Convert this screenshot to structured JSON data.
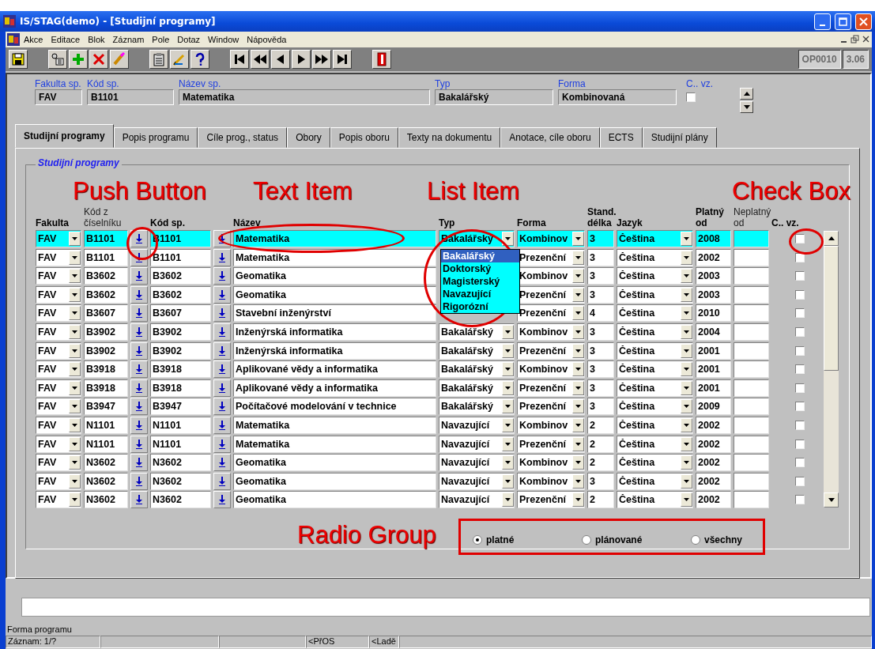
{
  "window": {
    "title": "IS/STAG(demo) - [Studijní programy]"
  },
  "menu": [
    "Akce",
    "Editace",
    "Blok",
    "Záznam",
    "Pole",
    "Dotaz",
    "Window",
    "Nápověda"
  ],
  "toolbar": {
    "form_code": "OP0010",
    "version": "3.06"
  },
  "header": {
    "fields": [
      {
        "label": "Fakulta sp.",
        "value": "FAV"
      },
      {
        "label": "Kód sp.",
        "value": "B1101"
      },
      {
        "label": "Název sp.",
        "value": "Matematika"
      },
      {
        "label": "Typ",
        "value": "Bakalářský"
      },
      {
        "label": "Forma",
        "value": "Kombinovaná"
      }
    ],
    "c_vz": {
      "label": "C.. vz.",
      "checked": false
    }
  },
  "tabs": [
    {
      "label": "Studijní programy",
      "selected": true
    },
    {
      "label": "Popis programu",
      "selected": false
    },
    {
      "label": "Cíle prog., status",
      "selected": false
    },
    {
      "label": "Obory",
      "selected": false
    },
    {
      "label": "Popis oboru",
      "selected": false
    },
    {
      "label": "Texty na dokumentu",
      "selected": false
    },
    {
      "label": "Anotace, cíle oboru",
      "selected": false
    },
    {
      "label": "ECTS",
      "selected": false
    },
    {
      "label": "Studijní plány",
      "selected": false
    }
  ],
  "group": {
    "title": "Studijní programy"
  },
  "table": {
    "columns": [
      "Fakulta",
      "Kód z číselníku",
      "Kód sp.",
      "Název",
      "Typ",
      "Forma",
      "Stand. délka",
      "Jazyk",
      "Platný od",
      "Neplatný od",
      "C.. vz."
    ],
    "rows": [
      {
        "fakulta": "FAV",
        "kod_ciselnik": "B1101",
        "kod_sp": "B1101",
        "nazev": "Matematika",
        "typ": "Bakalářský",
        "forma": "Kombinov",
        "delka": "3",
        "jazyk": "Čeština",
        "platny_od": "2008",
        "c_vz": false,
        "selected": true
      },
      {
        "fakulta": "FAV",
        "kod_ciselnik": "B1101",
        "kod_sp": "B1101",
        "nazev": "Matematika",
        "forma": "Prezenční",
        "delka": "3",
        "jazyk": "Čeština",
        "platny_od": "2002",
        "c_vz": false,
        "selected": false
      },
      {
        "fakulta": "FAV",
        "kod_ciselnik": "B3602",
        "kod_sp": "B3602",
        "nazev": "Geomatika",
        "forma": "Kombinov",
        "delka": "3",
        "jazyk": "Čeština",
        "platny_od": "2003",
        "c_vz": false,
        "selected": false
      },
      {
        "fakulta": "FAV",
        "kod_ciselnik": "B3602",
        "kod_sp": "B3602",
        "nazev": "Geomatika",
        "forma": "Prezenční",
        "delka": "3",
        "jazyk": "Čeština",
        "platny_od": "2003",
        "c_vz": false,
        "selected": false
      },
      {
        "fakulta": "FAV",
        "kod_ciselnik": "B3607",
        "kod_sp": "B3607",
        "nazev": "Stavební inženýrství",
        "forma": "Prezenční",
        "delka": "4",
        "jazyk": "Čeština",
        "platny_od": "2010",
        "c_vz": false,
        "selected": false
      },
      {
        "fakulta": "FAV",
        "kod_ciselnik": "B3902",
        "kod_sp": "B3902",
        "nazev": "Inženýrská informatika",
        "typ": "Bakalářský",
        "forma": "Kombinov",
        "delka": "3",
        "jazyk": "Čeština",
        "platny_od": "2004",
        "c_vz": false,
        "selected": false
      },
      {
        "fakulta": "FAV",
        "kod_ciselnik": "B3902",
        "kod_sp": "B3902",
        "nazev": "Inženýrská informatika",
        "typ": "Bakalářský",
        "forma": "Prezenční",
        "delka": "3",
        "jazyk": "Čeština",
        "platny_od": "2001",
        "c_vz": false,
        "selected": false
      },
      {
        "fakulta": "FAV",
        "kod_ciselnik": "B3918",
        "kod_sp": "B3918",
        "nazev": "Aplikované vědy a informatika",
        "typ": "Bakalářský",
        "forma": "Kombinov",
        "delka": "3",
        "jazyk": "Čeština",
        "platny_od": "2001",
        "c_vz": false,
        "selected": false
      },
      {
        "fakulta": "FAV",
        "kod_ciselnik": "B3918",
        "kod_sp": "B3918",
        "nazev": "Aplikované vědy a informatika",
        "typ": "Bakalářský",
        "forma": "Prezenční",
        "delka": "3",
        "jazyk": "Čeština",
        "platny_od": "2001",
        "c_vz": false,
        "selected": false
      },
      {
        "fakulta": "FAV",
        "kod_ciselnik": "B3947",
        "kod_sp": "B3947",
        "nazev": "Počítačové modelování v technice",
        "typ": "Bakalářský",
        "forma": "Prezenční",
        "delka": "3",
        "jazyk": "Čeština",
        "platny_od": "2009",
        "c_vz": false,
        "selected": false
      },
      {
        "fakulta": "FAV",
        "kod_ciselnik": "N1101",
        "kod_sp": "N1101",
        "nazev": "Matematika",
        "typ": "Navazující",
        "forma": "Kombinov",
        "delka": "2",
        "jazyk": "Čeština",
        "platny_od": "2002",
        "c_vz": false,
        "selected": false
      },
      {
        "fakulta": "FAV",
        "kod_ciselnik": "N1101",
        "kod_sp": "N1101",
        "nazev": "Matematika",
        "typ": "Navazující",
        "forma": "Prezenční",
        "delka": "2",
        "jazyk": "Čeština",
        "platny_od": "2002",
        "c_vz": false,
        "selected": false
      },
      {
        "fakulta": "FAV",
        "kod_ciselnik": "N3602",
        "kod_sp": "N3602",
        "nazev": "Geomatika",
        "typ": "Navazující",
        "forma": "Kombinov",
        "delka": "2",
        "jazyk": "Čeština",
        "platny_od": "2002",
        "c_vz": false,
        "selected": false
      },
      {
        "fakulta": "FAV",
        "kod_ciselnik": "N3602",
        "kod_sp": "N3602",
        "nazev": "Geomatika",
        "typ": "Navazující",
        "forma": "Kombinov",
        "delka": "3",
        "jazyk": "Čeština",
        "platny_od": "2002",
        "c_vz": false,
        "selected": false
      },
      {
        "fakulta": "FAV",
        "kod_ciselnik": "N3602",
        "kod_sp": "N3602",
        "nazev": "Geomatika",
        "typ": "Navazující",
        "forma": "Prezenční",
        "delka": "2",
        "jazyk": "Čeština",
        "platny_od": "2002",
        "c_vz": false,
        "selected": false
      }
    ]
  },
  "type_dropdown": {
    "options": [
      {
        "label": "Bakalářský",
        "selected": true
      },
      {
        "label": "Doktorský",
        "selected": false
      },
      {
        "label": "Magisterský",
        "selected": false
      },
      {
        "label": "Navazující",
        "selected": false
      },
      {
        "label": "Rigorózní",
        "selected": false
      }
    ]
  },
  "radio": [
    {
      "label": "platné",
      "selected": true
    },
    {
      "label": "plánované",
      "selected": false
    },
    {
      "label": "všechny",
      "selected": false
    }
  ],
  "annotations": [
    {
      "text": "Push Button",
      "kind": "ellipse"
    },
    {
      "text": "Text Item",
      "kind": "ellipse"
    },
    {
      "text": "List Item",
      "kind": "ellipse"
    },
    {
      "text": "Check Box",
      "kind": "ellipse"
    },
    {
      "text": "Radio Group",
      "kind": "rect"
    }
  ],
  "status": {
    "hint": "Forma programu",
    "cells": [
      "Záznam: 1/?",
      "",
      "",
      "<PřOS",
      "<Ladě",
      ""
    ]
  }
}
